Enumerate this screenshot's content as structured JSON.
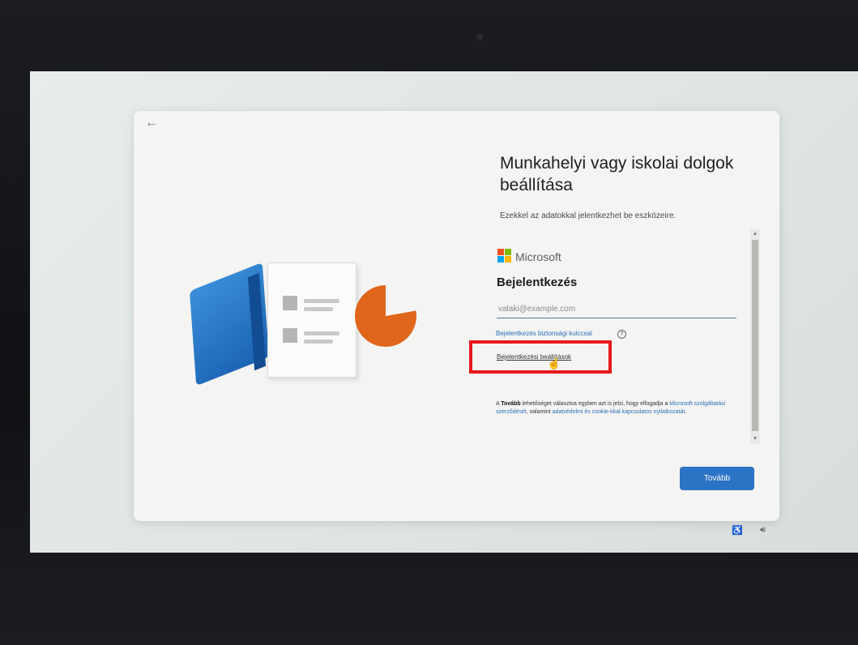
{
  "dialog": {
    "title": "Munkahelyi vagy iskolai dolgok beállítása",
    "subtitle": "Ezekkel az adatokkal jelentkezhet be eszközeire."
  },
  "signin": {
    "brand": "Microsoft",
    "heading": "Bejelentkezés",
    "email_placeholder": "valaki@example.com",
    "security_key_link": "Bejelentkezés biztonsági kulccsal",
    "options_link": "Bejelentkezési beállítások",
    "terms_prefix": "A ",
    "terms_bold": "Tovább",
    "terms_mid1": " lehetőséget választva egyben azt is jelzi, hogy elfogadja a ",
    "terms_link1": "Microsoft szolgáltatási szerződését",
    "terms_mid2": ", valamint ",
    "terms_link2": "adatvédelmi és cookie-kkal kapcsolatos nyilatkozatát",
    "terms_end": "."
  },
  "buttons": {
    "next": "Tovább",
    "back": "←"
  },
  "icons": {
    "back": "arrow-left-icon",
    "help": "help-circle-icon",
    "cursor": "hand-pointer-icon",
    "accessibility": "accessibility-icon",
    "volume": "volume-icon"
  },
  "colors": {
    "accent": "#2b73c4",
    "link": "#2a6fb8",
    "highlight": "#e8181c",
    "ms_red": "#f25022",
    "ms_green": "#7fba00",
    "ms_blue": "#00a4ef",
    "ms_yellow": "#ffb900"
  }
}
